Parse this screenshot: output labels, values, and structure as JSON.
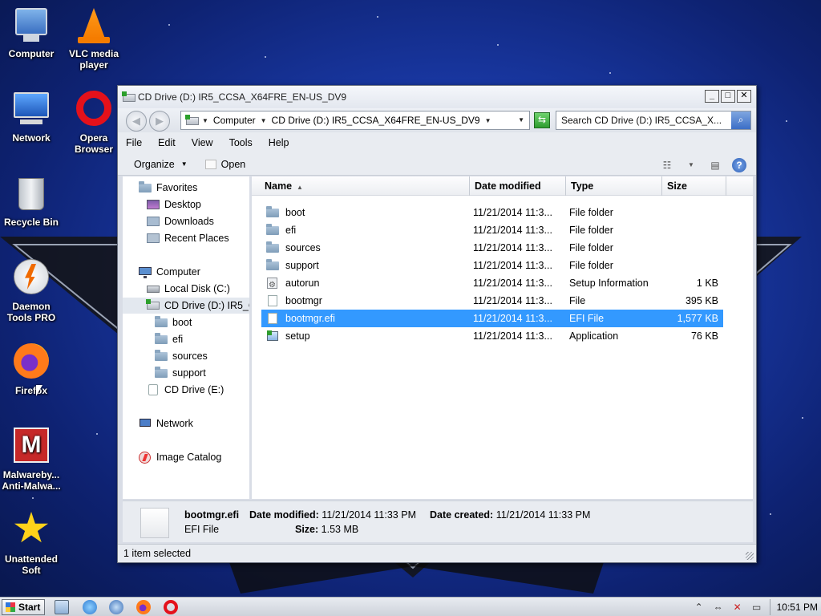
{
  "desktop": {
    "icons": [
      {
        "label": "Computer"
      },
      {
        "label": "VLC media\nplayer"
      },
      {
        "label": "Network"
      },
      {
        "label": "Opera\nBrowser"
      },
      {
        "label": "Recycle Bin"
      },
      {
        "label": "Daemon\nTools PRO"
      },
      {
        "label": "Firefox"
      },
      {
        "label": "Malwareby...\nAnti-Malwa..."
      },
      {
        "label": "Unattended\nSoft"
      }
    ]
  },
  "window": {
    "title": "CD Drive (D:) IR5_CCSA_X64FRE_EN-US_DV9",
    "address": {
      "crumbs": [
        "Computer",
        "CD Drive (D:) IR5_CCSA_X64FRE_EN-US_DV9"
      ]
    },
    "search": {
      "placeholder": "Search CD Drive (D:) IR5_CCSA_X..."
    },
    "menu": [
      "File",
      "Edit",
      "View",
      "Tools",
      "Help"
    ],
    "toolbar": {
      "organize": "Organize",
      "open": "Open"
    },
    "nav": {
      "favorites": "Favorites",
      "desktop": "Desktop",
      "downloads": "Downloads",
      "recent": "Recent Places",
      "computer": "Computer",
      "local_disk": "Local Disk (C:)",
      "cd_drive_d": "CD Drive (D:) IR5_C",
      "boot": "boot",
      "efi": "efi",
      "sources": "sources",
      "support": "support",
      "cd_drive_e": "CD Drive (E:)",
      "network": "Network",
      "image_catalog": "Image Catalog"
    },
    "columns": {
      "name": "Name",
      "date": "Date modified",
      "type": "Type",
      "size": "Size"
    },
    "files": [
      {
        "name": "boot",
        "date": "11/21/2014 11:3...",
        "type": "File folder",
        "size": "",
        "icon": "folder"
      },
      {
        "name": "efi",
        "date": "11/21/2014 11:3...",
        "type": "File folder",
        "size": "",
        "icon": "folder"
      },
      {
        "name": "sources",
        "date": "11/21/2014 11:3...",
        "type": "File folder",
        "size": "",
        "icon": "folder"
      },
      {
        "name": "support",
        "date": "11/21/2014 11:3...",
        "type": "File folder",
        "size": "",
        "icon": "folder"
      },
      {
        "name": "autorun",
        "date": "11/21/2014 11:3...",
        "type": "Setup Information",
        "size": "1 KB",
        "icon": "autorun"
      },
      {
        "name": "bootmgr",
        "date": "11/21/2014 11:3...",
        "type": "File",
        "size": "395 KB",
        "icon": "file"
      },
      {
        "name": "bootmgr.efi",
        "date": "11/21/2014 11:3...",
        "type": "EFI File",
        "size": "1,577 KB",
        "icon": "file"
      },
      {
        "name": "setup",
        "date": "11/21/2014 11:3...",
        "type": "Application",
        "size": "76 KB",
        "icon": "setup"
      }
    ],
    "details": {
      "name": "bootmgr.efi",
      "type": "EFI File",
      "date_modified_label": "Date modified:",
      "date_modified": "11/21/2014 11:33 PM",
      "date_created_label": "Date created:",
      "date_created": "11/21/2014 11:33 PM",
      "size_label": "Size:",
      "size": "1.53 MB"
    },
    "status": "1 item selected"
  },
  "taskbar": {
    "start": "Start",
    "clock": "10:51 PM"
  }
}
